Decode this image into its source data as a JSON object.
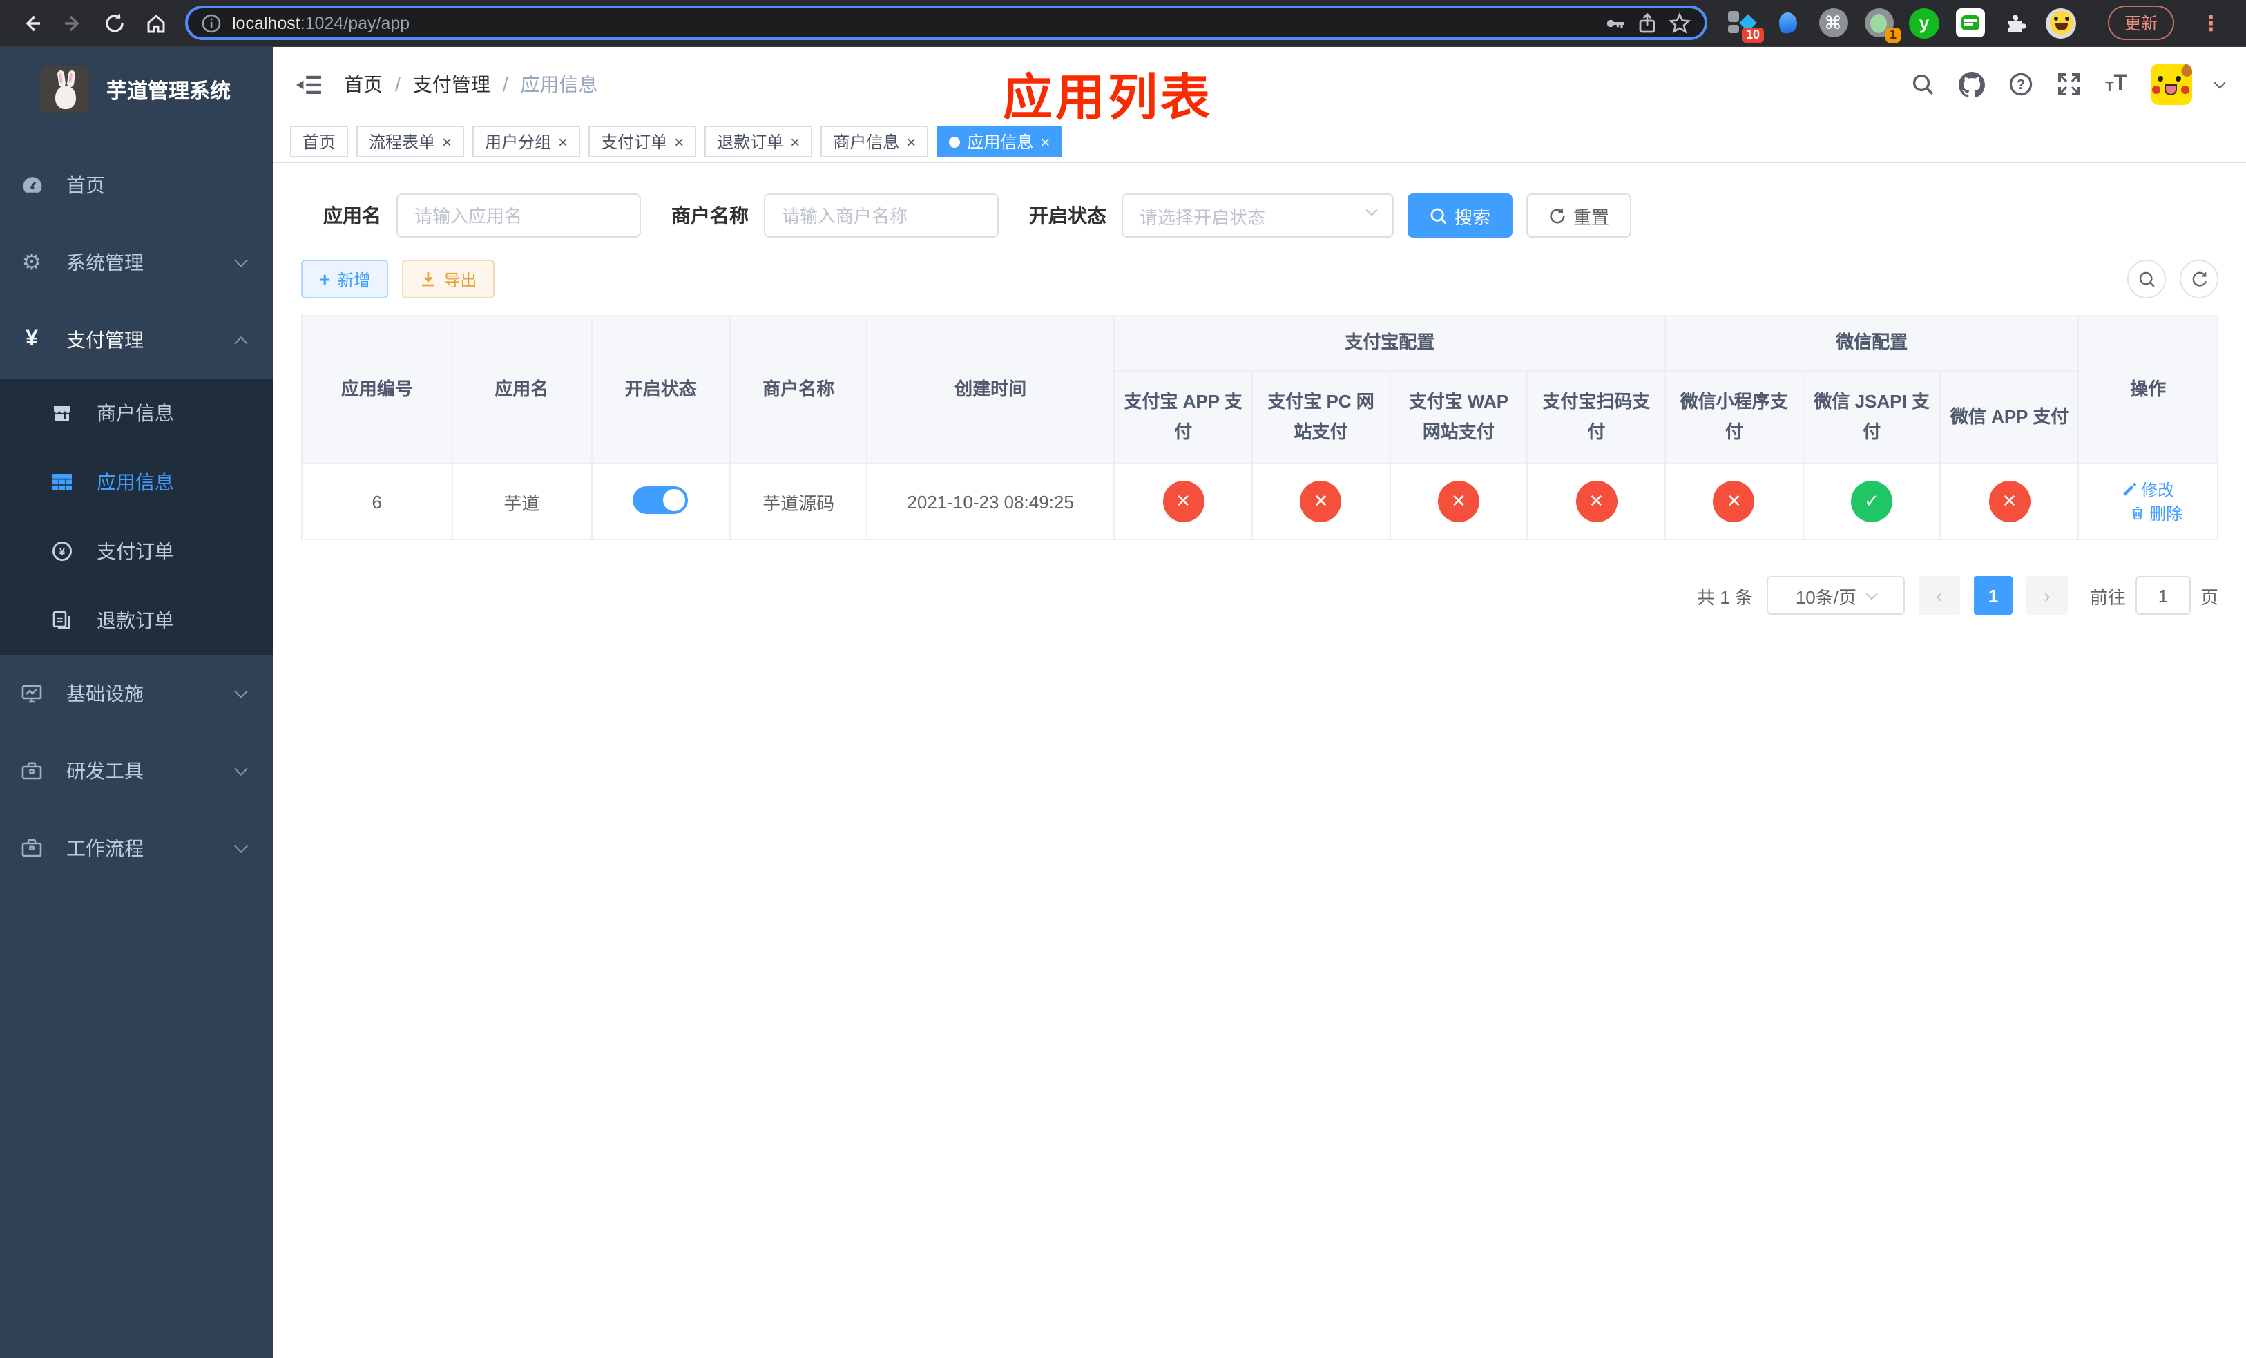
{
  "browser": {
    "url_host": "localhost",
    "url_path": ":1024/pay/app",
    "update_label": "更新",
    "ext_translate_badge": "10",
    "ext_proxy_badge": "1",
    "ext_y_label": "y",
    "ext_cmd_glyph": "⌘"
  },
  "sidebar": {
    "title": "芋道管理系统",
    "menu": [
      {
        "label": "首页"
      },
      {
        "label": "系统管理"
      },
      {
        "label": "支付管理"
      },
      {
        "label": "基础设施"
      },
      {
        "label": "研发工具"
      },
      {
        "label": "工作流程"
      }
    ],
    "submenu": [
      {
        "label": "商户信息"
      },
      {
        "label": "应用信息"
      },
      {
        "label": "支付订单"
      },
      {
        "label": "退款订单"
      }
    ]
  },
  "navbar": {
    "breadcrumb": [
      "首页",
      "支付管理",
      "应用信息"
    ],
    "annotation": "应用列表"
  },
  "tabs": [
    {
      "label": "首页"
    },
    {
      "label": "流程表单"
    },
    {
      "label": "用户分组"
    },
    {
      "label": "支付订单"
    },
    {
      "label": "退款订单"
    },
    {
      "label": "商户信息"
    },
    {
      "label": "应用信息"
    }
  ],
  "filters": {
    "app_name_label": "应用名",
    "app_name_placeholder": "请输入应用名",
    "merchant_label": "商户名称",
    "merchant_placeholder": "请输入商户名称",
    "status_label": "开启状态",
    "status_placeholder": "请选择开启状态",
    "search_label": "搜索",
    "reset_label": "重置"
  },
  "toolbar": {
    "add_label": "新增",
    "export_label": "导出"
  },
  "table": {
    "group_alipay": "支付宝配置",
    "group_wechat": "微信配置",
    "columns": [
      "应用编号",
      "应用名",
      "开启状态",
      "商户名称",
      "创建时间",
      "支付宝 APP 支付",
      "支付宝 PC 网站支付",
      "支付宝 WAP 网站支付",
      "支付宝扫码支付",
      "微信小程序支付",
      "微信 JSAPI 支付",
      "微信 APP 支付",
      "操作"
    ],
    "row": {
      "id": "6",
      "name": "芋道",
      "enabled": true,
      "merchant": "芋道源码",
      "created": "2021-10-23 08:49:25",
      "statuses": [
        false,
        false,
        false,
        false,
        false,
        true,
        false
      ],
      "edit_label": "修改",
      "delete_label": "删除"
    }
  },
  "pagination": {
    "total": "共 1 条",
    "page_size": "10条/页",
    "current": "1",
    "goto_label": "前往",
    "goto_value": "1",
    "page_suffix": "页"
  },
  "colors": {
    "accent": "#409eff",
    "danger": "#f4503c",
    "success": "#20c565",
    "annotation": "#fb2b01",
    "sidebar_bg": "#304156",
    "submenu_bg": "#1f2d3d"
  }
}
